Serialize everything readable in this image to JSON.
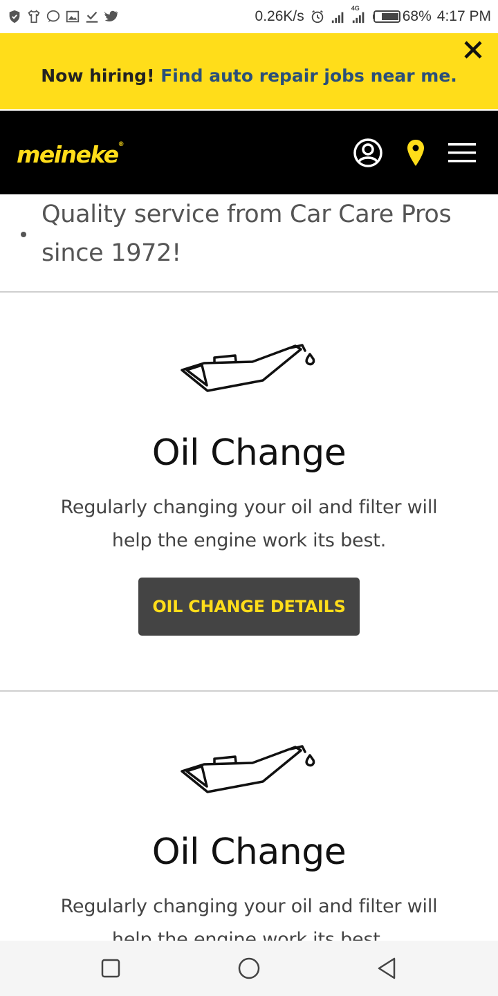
{
  "status_bar": {
    "network_speed": "0.26K/s",
    "network_type": "4G",
    "battery": "68%",
    "time": "4:17 PM",
    "left_icons": [
      "shield-icon",
      "shirt-icon",
      "chat-icon",
      "image-icon",
      "download-check-icon",
      "twitter-icon"
    ]
  },
  "banner": {
    "lead": "Now hiring!",
    "link": "Find auto repair jobs near me.",
    "close_icon": "close-icon"
  },
  "header": {
    "logo": "meineke",
    "logo_mark": "®",
    "icons": [
      "user-account-icon",
      "location-pin-icon",
      "hamburger-menu-icon"
    ]
  },
  "tagline": {
    "text": "Quality service from Car Care Pros since 1972!"
  },
  "services": [
    {
      "icon": "oil-can-icon",
      "title": "Oil Change",
      "description": "Regularly changing your oil and filter will help the engine work its best.",
      "button": "OIL CHANGE DETAILS"
    },
    {
      "icon": "oil-can-icon",
      "title": "Oil Change",
      "description": "Regularly changing your oil and filter will help the engine work its best."
    }
  ],
  "nav_bar": {
    "buttons": [
      "recents-square-icon",
      "home-circle-icon",
      "back-triangle-icon"
    ]
  },
  "colors": {
    "brand_yellow": "#ffdd1a",
    "header_black": "#000000",
    "banner_link": "#2a4f7a",
    "button_bg": "#444444"
  }
}
